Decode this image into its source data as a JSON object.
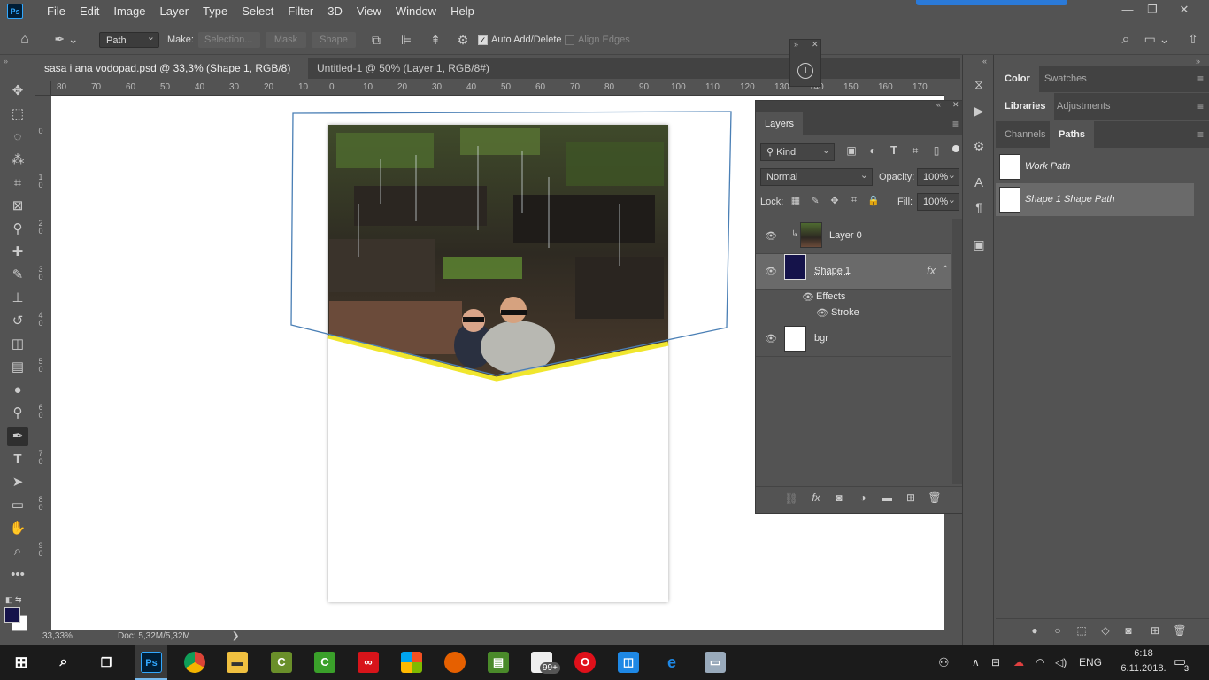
{
  "app": {
    "logo": "Ps"
  },
  "menu": [
    "File",
    "Edit",
    "Image",
    "Layer",
    "Type",
    "Select",
    "Filter",
    "3D",
    "View",
    "Window",
    "Help"
  ],
  "window_controls": {
    "minimize": "—",
    "restore": "❐",
    "close": "✕"
  },
  "options_bar": {
    "tool_mode": "Path",
    "make_label": "Make:",
    "selection_btn": "Selection...",
    "mask_btn": "Mask",
    "shape_btn": "Shape",
    "auto_add_delete": "Auto Add/Delete",
    "align_edges": "Align Edges"
  },
  "doc_tabs": [
    {
      "title": "sasa i ana vodopad.psd @ 33,3% (Shape 1, RGB/8) *",
      "close": "×"
    },
    {
      "title": "Untitled-1 @ 50% (Layer 1, RGB/8#) *",
      "close": "×"
    }
  ],
  "ruler_top": [
    "80",
    "70",
    "60",
    "50",
    "40",
    "30",
    "20",
    "10",
    "0",
    "10",
    "20",
    "30",
    "40",
    "50",
    "60",
    "70",
    "80",
    "90",
    "100",
    "110",
    "120",
    "130",
    "140",
    "150",
    "160",
    "170"
  ],
  "ruler_left": [
    "0",
    "1 0",
    "2 0",
    "3 0",
    "4 0",
    "5 0",
    "6 0",
    "7 0",
    "8 0",
    "9 0"
  ],
  "status": {
    "zoom": "33,33%",
    "doc": "Doc: 5,32M/5,32M",
    "arrow": "❯"
  },
  "layers_panel": {
    "tab": "Layers",
    "filter_kind": "Kind",
    "blend_mode": "Normal",
    "opacity_label": "Opacity:",
    "opacity": "100%",
    "lock_label": "Lock:",
    "fill_label": "Fill:",
    "fill": "100%",
    "layers": [
      {
        "name": "Layer 0"
      },
      {
        "name": "Shape 1",
        "fx": "fx"
      },
      {
        "name": "Effects"
      },
      {
        "name": "Stroke"
      },
      {
        "name": "bgr"
      }
    ]
  },
  "right_panel": {
    "tabs1": [
      "Color",
      "Swatches"
    ],
    "tabs2": [
      "Libraries",
      "Adjustments"
    ],
    "tabs3": [
      "Channels",
      "Paths"
    ],
    "paths": [
      "Work Path",
      "Shape 1 Shape Path"
    ]
  },
  "taskbar": {
    "time": "6:18",
    "date": "6.11.2018.",
    "lang": "ENG",
    "notif": "3",
    "badge": "99+"
  },
  "colors": {
    "accent": "#31a8ff",
    "stroke_yellow": "#f0e62e",
    "path_blue": "#4a7fb5",
    "fg_swatch": "#15134a"
  }
}
